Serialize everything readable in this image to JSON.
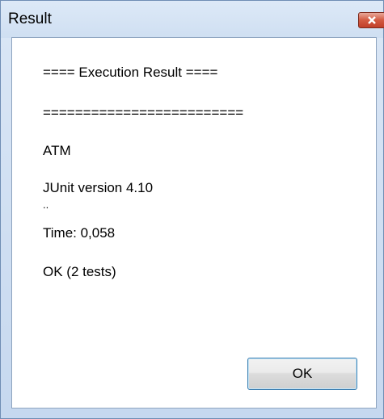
{
  "window": {
    "title": "Result",
    "close_icon": "close-icon"
  },
  "output": {
    "lines": [
      "==== Execution Result ====",
      "=========================",
      "ATM",
      "JUnit version 4.10",
      "..",
      "Time: 0,058",
      "OK (2 tests)"
    ]
  },
  "buttons": {
    "ok_label": "OK"
  },
  "colors": {
    "close_button": "#d35a41",
    "button_border": "#3c7fb1"
  }
}
